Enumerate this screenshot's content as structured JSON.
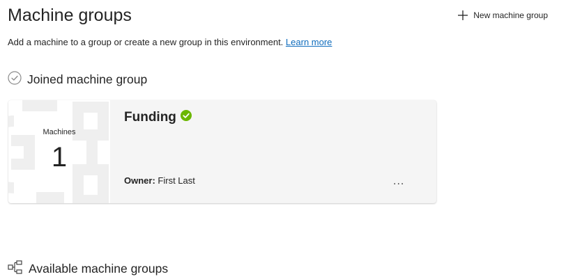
{
  "header": {
    "title": "Machine groups",
    "new_group_label": "New machine group",
    "new_group_icon": "plus-icon"
  },
  "subtitle": {
    "text": "Add a machine to a group or create a new group in this environment.",
    "link": "Learn more"
  },
  "joined": {
    "title": "Joined machine group",
    "icon": "check-circle-outline-icon"
  },
  "card": {
    "machines_label": "Machines",
    "machines_count": "1",
    "name": "Funding",
    "status_icon": "check-circle-filled-icon",
    "status_color": "#6bb700",
    "owner_label": "Owner:",
    "owner_value": "First Last",
    "more_label": "..."
  },
  "available": {
    "title": "Available machine groups",
    "icon": "tree-structure-icon"
  },
  "colors": {
    "link": "#0f6cbd",
    "card_bg": "#f5f5f5",
    "text": "#242424"
  }
}
